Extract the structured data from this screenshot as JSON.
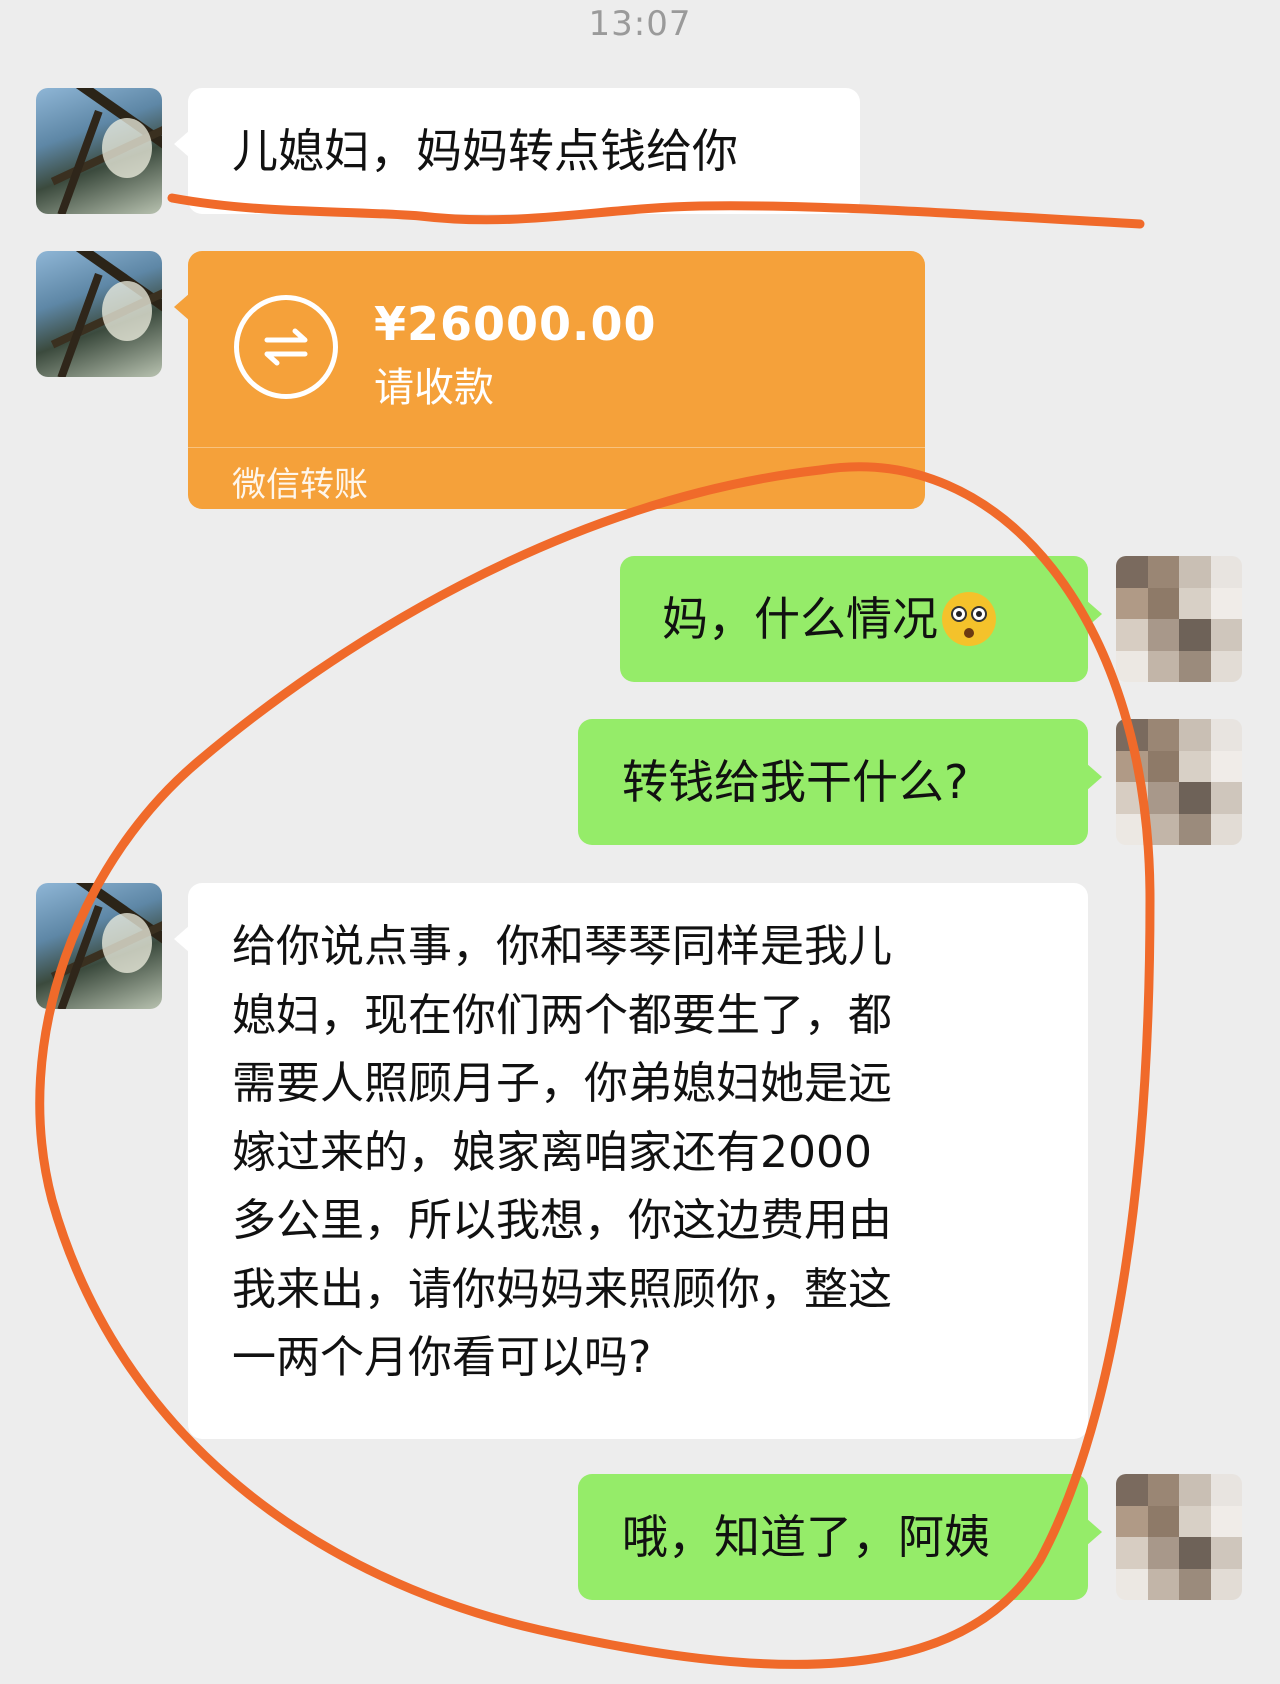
{
  "status": {
    "time": "13:07"
  },
  "chat": {
    "messages": [
      {
        "from": "mother-in-law",
        "text": "儿媳妇，妈妈转点钱给你"
      },
      {
        "from": "mother-in-law",
        "type": "transfer",
        "amount": "¥26000.00",
        "status": "请收款",
        "label": "微信转账"
      },
      {
        "from": "me",
        "text": "妈，什么情况"
      },
      {
        "from": "me",
        "text": "转钱给我干什么?"
      },
      {
        "from": "mother-in-law",
        "lines": [
          "给你说点事，你和琴琴同样是我儿",
          "媳妇，现在你们两个都要生了，都",
          "需要人照顾月子，你弟媳妇她是远",
          "嫁过来的，娘家离咱家还有2000",
          "多公里，所以我想，你这边费用由",
          "我来出，请你妈妈来照顾你，整这",
          "一两个月你看可以吗?"
        ]
      },
      {
        "from": "me",
        "text": "哦，知道了，阿姨"
      }
    ]
  },
  "emoji": "flushed-face-icon",
  "colors": {
    "background": "#ededed",
    "green_bubble": "#95ec69",
    "transfer": "#f5a13a",
    "annotation": "#f06a2a"
  }
}
